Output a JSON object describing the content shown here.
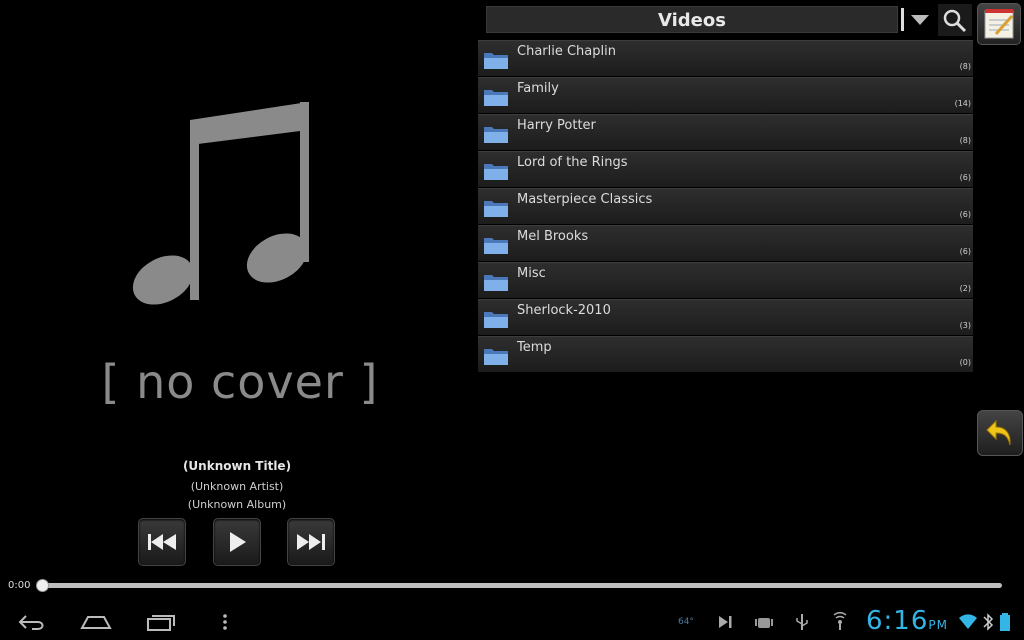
{
  "cover": {
    "placeholder_text": "[ no cover ]"
  },
  "track": {
    "title": "(Unknown Title)",
    "artist": "(Unknown Artist)",
    "album": "(Unknown Album)"
  },
  "player": {
    "elapsed": "0:00",
    "progress": 0
  },
  "browser": {
    "title": "Videos",
    "folders": [
      {
        "name": "Charlie Chaplin",
        "count": "(8)"
      },
      {
        "name": "Family",
        "count": "(14)"
      },
      {
        "name": "Harry Potter",
        "count": "(8)"
      },
      {
        "name": "Lord of the Rings",
        "count": "(6)"
      },
      {
        "name": "Masterpiece Classics",
        "count": "(6)"
      },
      {
        "name": "Mel Brooks",
        "count": "(6)"
      },
      {
        "name": "Misc",
        "count": "(2)"
      },
      {
        "name": "Sherlock-2010",
        "count": "(3)"
      },
      {
        "name": "Temp",
        "count": "(0)"
      }
    ]
  },
  "statusbar": {
    "temperature": "64°",
    "time": "6:16",
    "ampm": "PM"
  },
  "colors": {
    "accent": "#33b5e5",
    "folder": "#6b9bd8"
  }
}
